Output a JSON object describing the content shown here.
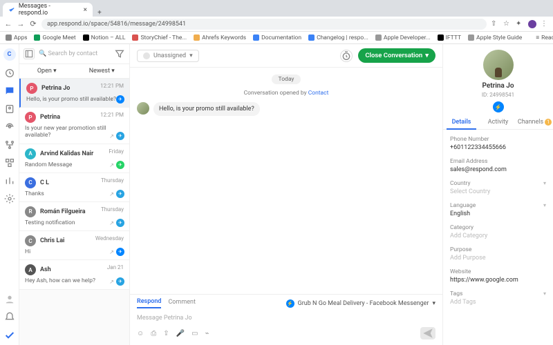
{
  "browser": {
    "tab_title": "Messages - respond.io",
    "url": "app.respond.io/space/54816/message/24998541",
    "bookmarks": [
      "Apps",
      "Google Meet",
      "Notion – ALL",
      "StoryChief - The...",
      "Ahrefs Keywords",
      "Documentation",
      "Changelog | respo...",
      "Apple Developer...",
      "IFTTT",
      "Apple Style Guide"
    ],
    "reading_list": "Reading List"
  },
  "rail": {
    "workspace_initial": "C"
  },
  "convlist": {
    "search_placeholder": "Search by contact",
    "filter_status": "Open",
    "filter_sort": "Newest",
    "items": [
      {
        "name": "Petrina Jo",
        "time": "12:21 PM",
        "snippet": "Hello, is your promo still available?",
        "avatar_bg": "#e4566a",
        "platform_bg": "#0084ff",
        "selected": true
      },
      {
        "name": "Petrina",
        "time": "12:21 PM",
        "snippet": "Is your new year promotion still available?",
        "avatar_bg": "#e4566a",
        "platform_bg": "#27a3e2"
      },
      {
        "name": "Arvind Kalidas Nair",
        "time": "Friday",
        "snippet": "Random Message",
        "avatar_bg": "#2cb6c9",
        "platform_bg": "#25d366"
      },
      {
        "name": "C L",
        "time": "Thursday",
        "snippet": "Thanks",
        "avatar_bg": "#3b6fe0",
        "platform_bg": "#27a3e2"
      },
      {
        "name": "Román Filgueira",
        "time": "Thursday",
        "snippet": "Testing notification",
        "avatar_bg": "#888",
        "platform_bg": "#27a3e2"
      },
      {
        "name": "Chris Lai",
        "time": "Wednesday",
        "snippet": "Hi",
        "avatar_bg": "#888",
        "platform_bg": "#0084ff"
      },
      {
        "name": "Ash",
        "time": "Jan 21",
        "snippet": "Hey Ash, how can we help?",
        "avatar_bg": "#555",
        "platform_bg": "#27a3e2"
      }
    ]
  },
  "chat": {
    "assignee": "Unassigned",
    "close_label": "Close Conversation",
    "date_chip": "Today",
    "opened_prefix": "Conversation opened by ",
    "opened_actor": "Contact",
    "message": "Hello, is your promo still available?",
    "tab_respond": "Respond",
    "tab_comment": "Comment",
    "channel": "Grub N Go Meal Delivery - Facebook Messenger",
    "input_placeholder": "Message Petrina Jo"
  },
  "details": {
    "name": "Petrina Jo",
    "id_prefix": "ID: ",
    "id": "24998541",
    "tabs": {
      "details": "Details",
      "activity": "Activity",
      "channels": "Channels",
      "channels_badge": "1"
    },
    "fields": [
      {
        "label": "Phone Number",
        "value": "+601122334455666"
      },
      {
        "label": "Email Address",
        "value": "sales@respond.com"
      },
      {
        "label": "Country",
        "value": "Select Country",
        "placeholder": true,
        "chevron": true
      },
      {
        "label": "Language",
        "value": "English",
        "chevron": true
      },
      {
        "label": "Category",
        "value": "Add Category",
        "placeholder": true
      },
      {
        "label": "Purpose",
        "value": "Add Purpose",
        "placeholder": true
      },
      {
        "label": "Website",
        "value": "https://www.google.com"
      },
      {
        "label": "Tags",
        "value": "Add Tags",
        "placeholder": true,
        "chevron": true
      }
    ]
  }
}
